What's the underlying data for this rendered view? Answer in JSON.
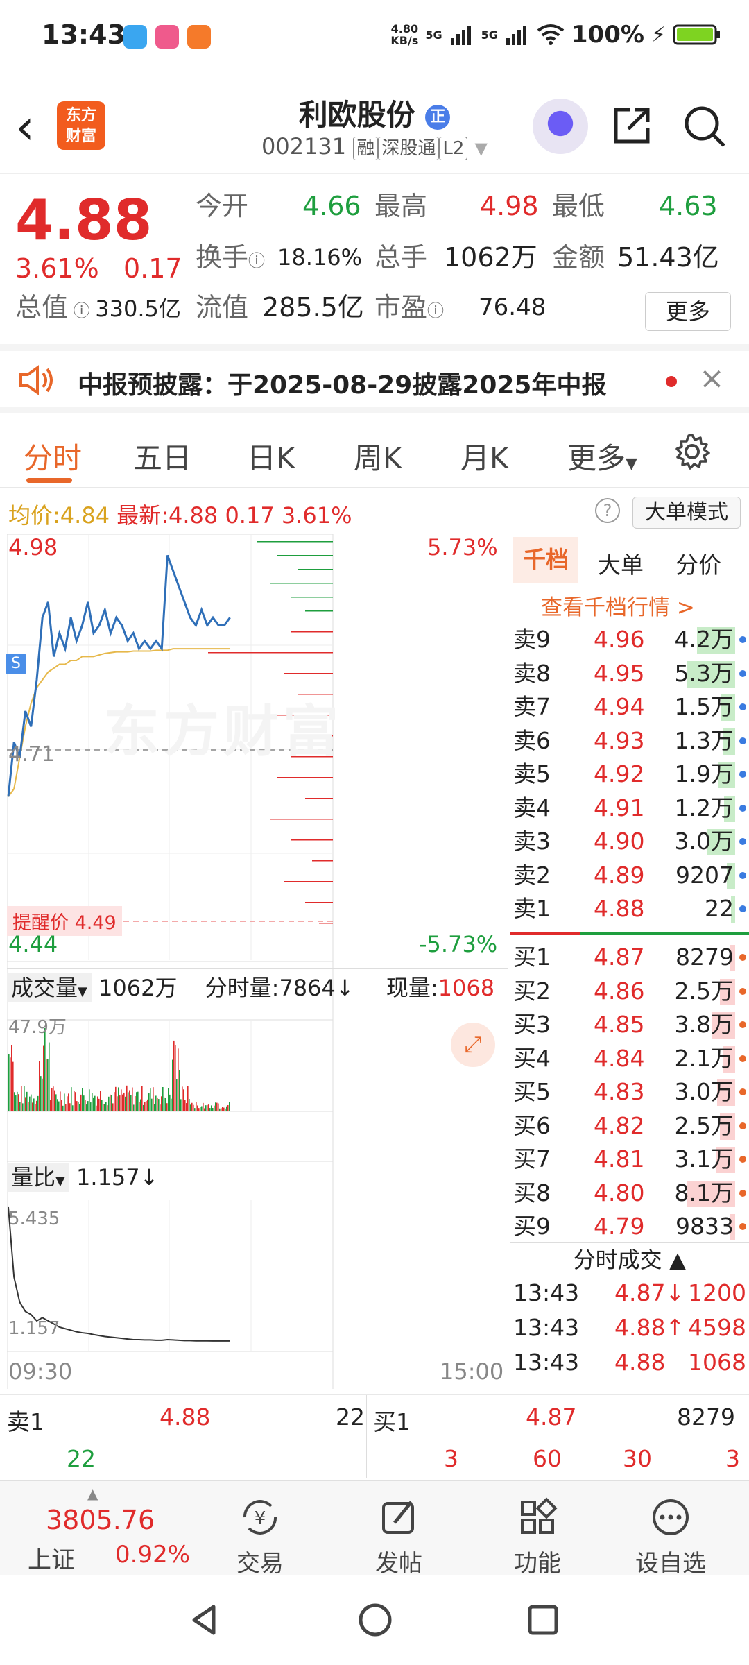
{
  "status": {
    "time": "13:43",
    "net_speed": "4.80",
    "net_unit": "KB/s",
    "signal": "5G",
    "battery": "100%"
  },
  "header": {
    "title": "利欧股份",
    "code": "002131",
    "tags": [
      "融",
      "深股通",
      "L2"
    ]
  },
  "quote": {
    "price": "4.88",
    "change_pct": "3.61%",
    "change": "0.17",
    "open_label": "今开",
    "open": "4.66",
    "high_label": "最高",
    "high": "4.98",
    "low_label": "最低",
    "low": "4.63",
    "turnover_label": "换手",
    "turnover": "18.16%",
    "volume_label": "总手",
    "volume": "1062万",
    "amount_label": "金额",
    "amount": "51.43亿",
    "mktcap_label": "总值",
    "mktcap": "330.5亿",
    "float_label": "流值",
    "float": "285.5亿",
    "pe_label": "市盈",
    "pe": "76.48",
    "more_label": "更多"
  },
  "notice": {
    "text": "中报预披露：于2025-08-29披露2025年中报"
  },
  "tabs": [
    "分时",
    "五日",
    "日K",
    "周K",
    "月K",
    "更多"
  ],
  "infobar": {
    "avg_label": "均价:",
    "avg": "4.84",
    "latest_label": "最新:",
    "latest": "4.88",
    "change": "0.17",
    "pct": "3.61%",
    "mode_btn": "大单模式"
  },
  "chart": {
    "top_price": "4.98",
    "top_pct": "5.73%",
    "mid_price": "4.71",
    "bottom_price": "4.44",
    "bottom_pct": "-5.73%",
    "alert_label": "提醒价 4.49",
    "time_start": "09:30",
    "time_end": "15:00",
    "s_marker": "S",
    "vol_label": "成交量",
    "vol_total": "1062万",
    "vol_unit_label": "分时量:7864↓",
    "vol_now_label": "现量:",
    "vol_now": "1068",
    "vol_max": "47.9万",
    "ratio_label": "量比",
    "ratio": "1.157↓",
    "ratio_max": "5.435",
    "ratio_min": "1.157",
    "watermark": "东方财富"
  },
  "chart_data": {
    "type": "line",
    "price_range": [
      4.44,
      4.98
    ],
    "prev_close": 4.71,
    "price": [
      4.65,
      4.72,
      4.7,
      4.76,
      4.74,
      4.8,
      4.88,
      4.9,
      4.83,
      4.86,
      4.84,
      4.88,
      4.85,
      4.87,
      4.9,
      4.86,
      4.87,
      4.89,
      4.86,
      4.88,
      4.87,
      4.85,
      4.86,
      4.84,
      4.85,
      4.84,
      4.85,
      4.84,
      4.96,
      4.94,
      4.92,
      4.9,
      4.88,
      4.87,
      4.89,
      4.87,
      4.88,
      4.87,
      4.87,
      4.88
    ],
    "avg": [
      4.65,
      4.66,
      4.7,
      4.74,
      4.77,
      4.79,
      4.8,
      4.81,
      4.815,
      4.82,
      4.82,
      4.825,
      4.825,
      4.83,
      4.83,
      4.83,
      4.832,
      4.834,
      4.835,
      4.836,
      4.836,
      4.836,
      4.837,
      4.837,
      4.837,
      4.837,
      4.838,
      4.838,
      4.838,
      4.84,
      4.84,
      4.84,
      4.84,
      4.84,
      4.84,
      4.84,
      4.84,
      4.84,
      4.84,
      4.84
    ],
    "volume_ratio": [
      5.435,
      3.2,
      2.4,
      2.1,
      2.0,
      1.8,
      1.9,
      1.8,
      1.7,
      1.6,
      1.55,
      1.5,
      1.45,
      1.42,
      1.4,
      1.36,
      1.33,
      1.3,
      1.28,
      1.26,
      1.24,
      1.22,
      1.2,
      1.2,
      1.19,
      1.19,
      1.18,
      1.18,
      1.2,
      1.19,
      1.18,
      1.17,
      1.17,
      1.16,
      1.16,
      1.16,
      1.157,
      1.157,
      1.157,
      1.157
    ]
  },
  "orderbook": {
    "tabs": [
      "千档",
      "大单",
      "分价"
    ],
    "link": "查看千档行情 >",
    "asks": [
      {
        "l": "卖9",
        "p": "4.96",
        "v": "4.2万"
      },
      {
        "l": "卖8",
        "p": "4.95",
        "v": "5.3万"
      },
      {
        "l": "卖7",
        "p": "4.94",
        "v": "1.5万"
      },
      {
        "l": "卖6",
        "p": "4.93",
        "v": "1.3万"
      },
      {
        "l": "卖5",
        "p": "4.92",
        "v": "1.9万"
      },
      {
        "l": "卖4",
        "p": "4.91",
        "v": "1.2万"
      },
      {
        "l": "卖3",
        "p": "4.90",
        "v": "3.0万"
      },
      {
        "l": "卖2",
        "p": "4.89",
        "v": "9207"
      },
      {
        "l": "卖1",
        "p": "4.88",
        "v": "22"
      }
    ],
    "bids": [
      {
        "l": "买1",
        "p": "4.87",
        "v": "8279"
      },
      {
        "l": "买2",
        "p": "4.86",
        "v": "2.5万"
      },
      {
        "l": "买3",
        "p": "4.85",
        "v": "3.8万"
      },
      {
        "l": "买4",
        "p": "4.84",
        "v": "2.1万"
      },
      {
        "l": "买5",
        "p": "4.83",
        "v": "3.0万"
      },
      {
        "l": "买6",
        "p": "4.82",
        "v": "2.5万"
      },
      {
        "l": "买7",
        "p": "4.81",
        "v": "3.1万"
      },
      {
        "l": "买8",
        "p": "4.80",
        "v": "8.1万"
      },
      {
        "l": "买9",
        "p": "4.79",
        "v": "9833"
      }
    ],
    "trades_title": "分时成交",
    "trades": [
      {
        "t": "13:43",
        "p": "4.87",
        "a": "↓",
        "v": "1200"
      },
      {
        "t": "13:43",
        "p": "4.88",
        "a": "↑",
        "v": "4598"
      },
      {
        "t": "13:43",
        "p": "4.88",
        "a": "",
        "v": "1068"
      }
    ]
  },
  "bottom": {
    "sell1_label": "卖1",
    "sell1_price": "4.88",
    "sell1_vol": "22",
    "buy1_label": "买1",
    "buy1_price": "4.87",
    "buy1_vol": "8279",
    "sell_queue": [
      "22"
    ],
    "buy_queue": [
      "3",
      "60",
      "30",
      "3"
    ]
  },
  "footer": {
    "index_value": "3805.76",
    "index_name": "上证",
    "index_pct": "0.92%",
    "items": [
      "交易",
      "发帖",
      "功能",
      "设自选"
    ]
  }
}
